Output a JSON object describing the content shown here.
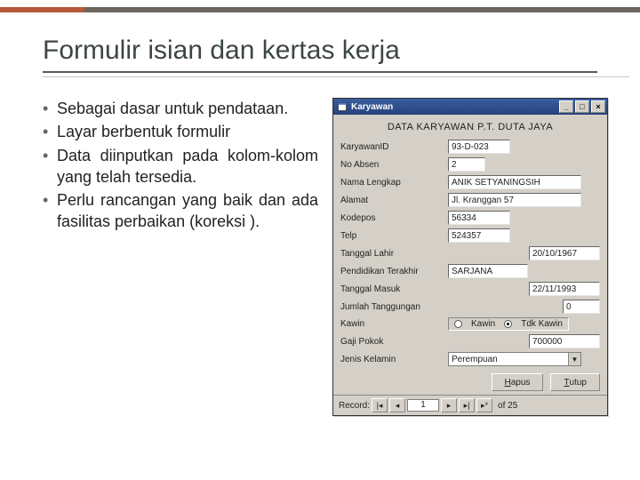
{
  "title": "Formulir isian dan kertas kerja",
  "bullets": [
    "Sebagai dasar untuk pendataan.",
    "Layar berbentuk formulir",
    "Data diinputkan pada kolom-kolom yang telah tersedia.",
    "Perlu rancangan yang baik dan ada fasilitas perbaikan (koreksi )."
  ],
  "form": {
    "window_title": "Karyawan",
    "heading": "DATA KARYAWAN P.T. DUTA JAYA",
    "labels": {
      "id": "KaryawanID",
      "noabsen": "No Absen",
      "nama": "Nama Lengkap",
      "alamat": "Alamat",
      "kodepos": "Kodepos",
      "telp": "Telp",
      "lahir": "Tanggal Lahir",
      "pendidikan": "Pendidikan Terakhir",
      "masuk": "Tanggal Masuk",
      "tanggungan": "Jumlah Tanggungan",
      "kawin": "Kawin",
      "gaji": "Gaji Pokok",
      "kelamin": "Jenis Kelamin"
    },
    "values": {
      "id": "93-D-023",
      "noabsen": "2",
      "nama": "ANIK SETYANINGSIH",
      "alamat": "Jl. Kranggan 57",
      "kodepos": "56334",
      "telp": "524357",
      "lahir": "20/10/1967",
      "pendidikan": "SARJANA",
      "masuk": "22/11/1993",
      "tanggungan": "0",
      "gaji": "700000",
      "kelamin": "Perempuan"
    },
    "radio": {
      "kawin": "Kawin",
      "tdk": "Tdk Kawin"
    },
    "buttons": {
      "hapus": "Hapus",
      "tutup": "Tutup"
    },
    "nav": {
      "label": "Record:",
      "pos": "1",
      "of": "of  25"
    }
  }
}
